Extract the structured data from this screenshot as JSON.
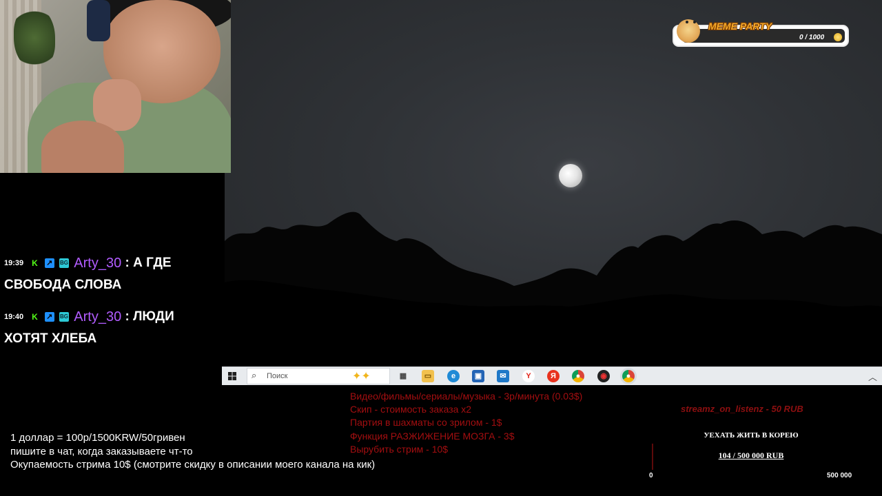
{
  "chat": {
    "messages": [
      {
        "time": "19:39",
        "user": "Arty_30",
        "separator": ":",
        "text": "А ГДЕ СВОБОДА СЛОВА"
      },
      {
        "time": "19:40",
        "user": "Arty_30",
        "separator": ":",
        "text": "ЛЮДИ ХОТЯТ ХЛЕБА"
      }
    ]
  },
  "taskbar": {
    "search_placeholder": "Поиск",
    "icons": [
      "windows-start-icon",
      "task-view-icon",
      "file-explorer-icon",
      "edge-icon",
      "store-icon",
      "outlook-icon",
      "yandex-browser-icon",
      "yandex-icon",
      "chrome-icon",
      "obs-icon",
      "chrome-profile-icon",
      "chevron-up-icon"
    ]
  },
  "price_list": [
    "Видео/фильмы/сериалы/музыка - 3р/минута (0.03$)",
    "Скип - стоимость заказа x2",
    "Партия в шахматы со зрилом - 1$",
    "Функция РАЗЖИЖЕНИЕ МОЗГА - 3$",
    "Вырубить стрим - 10$"
  ],
  "notes": [
    "1 доллар = 100р/1500KRW/50гривен",
    "пишите в чат, когда заказываете чт-то",
    "Окупаемость стрима 10$ (смотрите скидку в описании моего канала на кик)"
  ],
  "alert": {
    "text": "streamz_on_listenz - 50 RUB"
  },
  "goal": {
    "title": "УЕХАТЬ ЖИТЬ В КОРЕЮ",
    "progress_text": "104 / 500 000 RUB",
    "current": 104,
    "target": 500000,
    "min_label": "0",
    "max_label": "500 000"
  },
  "meme_party": {
    "title": "MEME PARTY",
    "count": "0 / 1000",
    "current": 0,
    "target": 1000
  },
  "colors": {
    "chat_username": "#b15cff",
    "price_list": "#a30e10",
    "kick_green": "#53fc18",
    "meme_title": "#f4a92a"
  }
}
